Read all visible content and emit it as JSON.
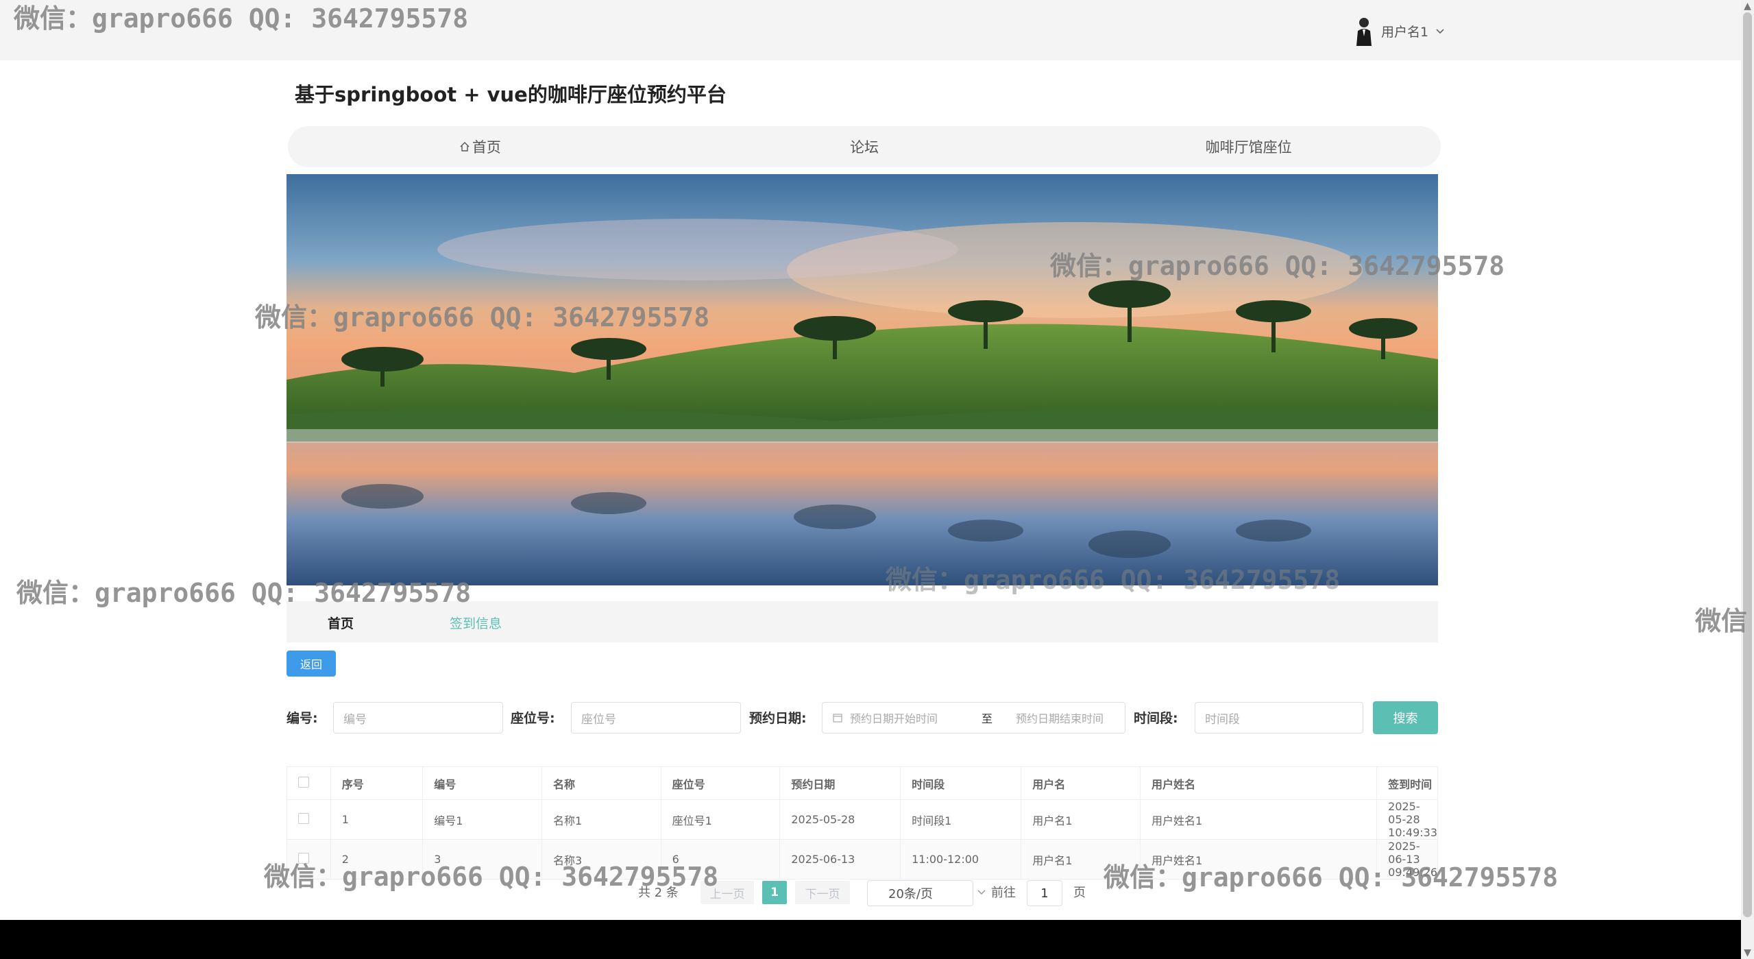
{
  "header": {
    "username": "用户名1",
    "chevron": "chevron-down-icon"
  },
  "watermark": "微信：grapro666 QQ: 3642795578",
  "watermark_partial": "微信",
  "site": {
    "title": "基于springboot + vue的咖啡厅座位预约平台"
  },
  "nav": {
    "items": [
      {
        "label": "首页",
        "icon": "home-icon"
      },
      {
        "label": "论坛"
      },
      {
        "label": "咖啡厅馆座位"
      }
    ]
  },
  "banner": {
    "description_icon": "landscape-image"
  },
  "subnav": {
    "home": "首页",
    "current": "签到信息"
  },
  "buttons": {
    "back": "返回",
    "search": "搜索"
  },
  "filters": {
    "code_label": "编号:",
    "code_placeholder": "编号",
    "seat_label": "座位号:",
    "seat_placeholder": "座位号",
    "date_label": "预约日期:",
    "date_start_placeholder": "预约日期开始时间",
    "date_sep": "至",
    "date_end_placeholder": "预约日期结束时间",
    "slot_label": "时间段:",
    "slot_placeholder": "时间段"
  },
  "table": {
    "headers": [
      "序号",
      "编号",
      "名称",
      "座位号",
      "预约日期",
      "时间段",
      "用户名",
      "用户姓名",
      "签到时间"
    ],
    "rows": [
      [
        "1",
        "编号1",
        "名称1",
        "座位号1",
        "2025-05-28",
        "时间段1",
        "用户名1",
        "用户姓名1",
        "2025-05-28 10:49:33"
      ],
      [
        "2",
        "3",
        "名称3",
        "6",
        "2025-06-13",
        "11:00-12:00",
        "用户名1",
        "用户姓名1",
        "2025-06-13 09:49:26"
      ]
    ]
  },
  "pagination": {
    "total": "共 2 条",
    "prev": "上一页",
    "current": "1",
    "next": "下一页",
    "page_size": "20条/页",
    "goto": "前往",
    "goto_value": "1",
    "page_unit": "页"
  }
}
